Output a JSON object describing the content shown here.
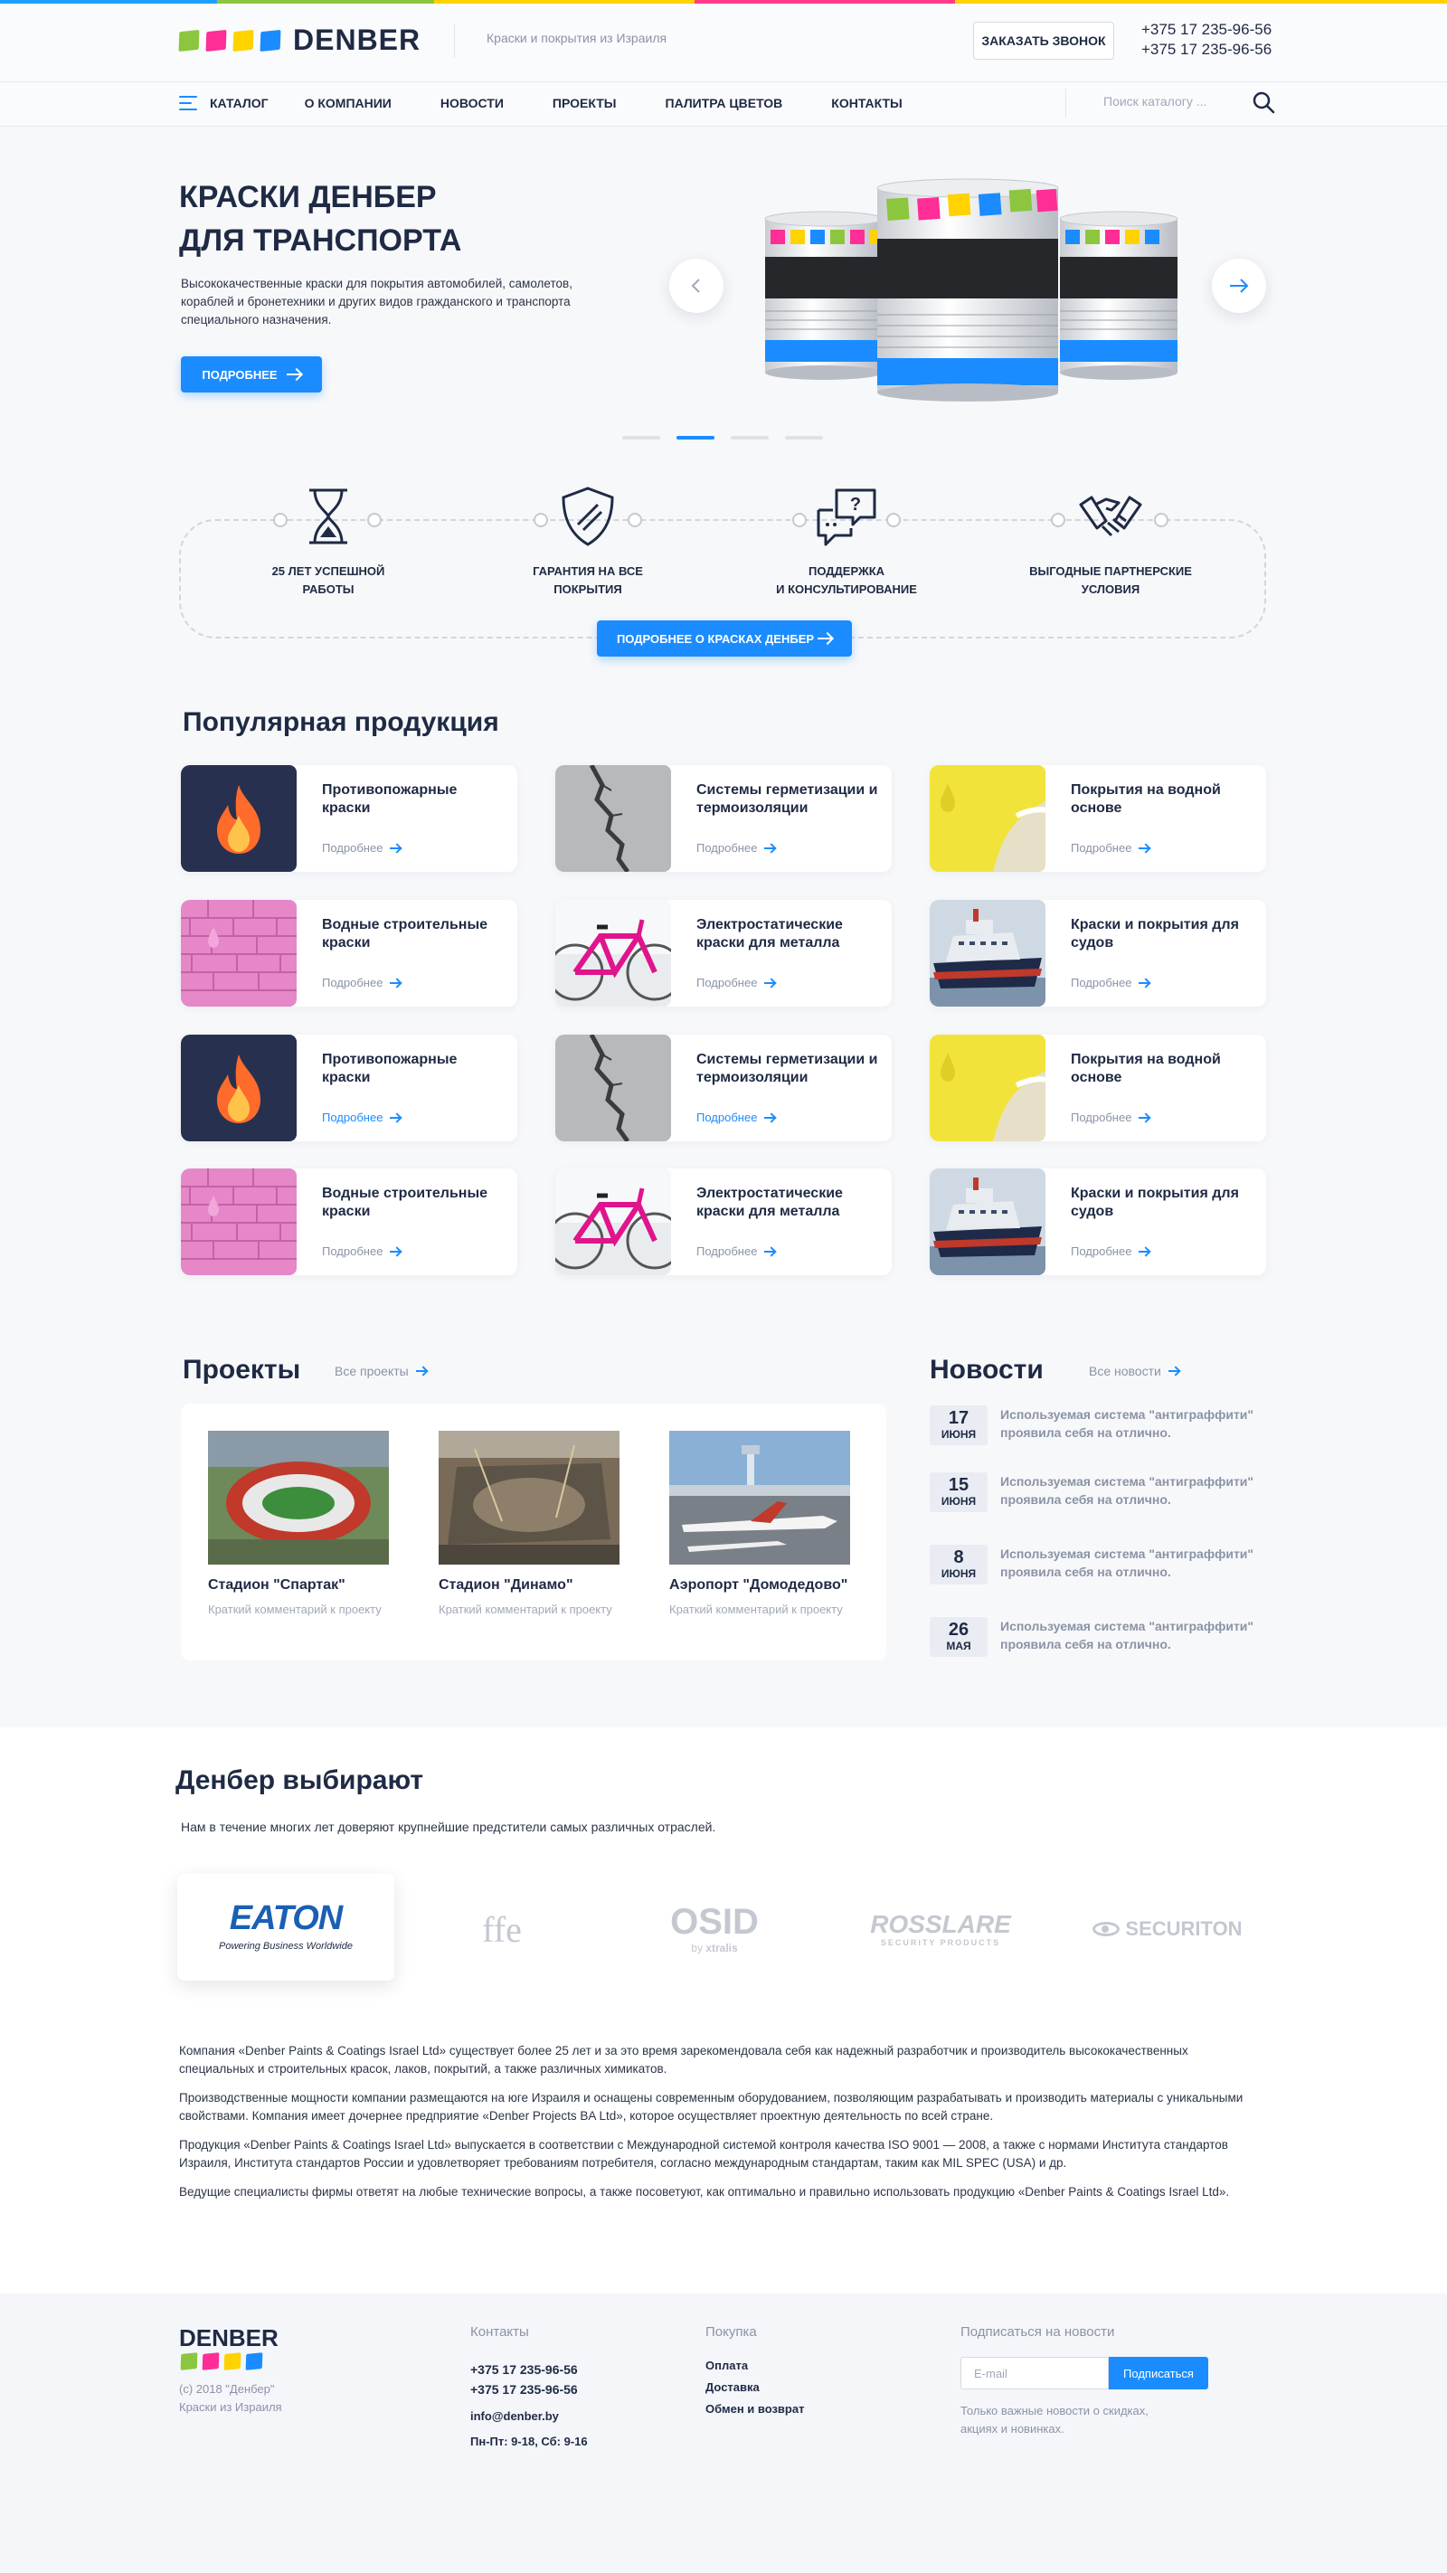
{
  "header": {
    "logo_text": "DENBER",
    "tagline": "Краски и покрытия из Израиля",
    "call_button": "ЗАКАЗАТЬ ЗВОНОК",
    "phone1": "+375 17 235-96-56",
    "phone2": "+375 17 235-96-56",
    "brand_colors": [
      "#8cc63f",
      "#ff2d96",
      "#ffd200",
      "#1a8cff"
    ]
  },
  "nav": {
    "catalog": "КАТАЛОГ",
    "items": [
      "О КОМПАНИИ",
      "НОВОСТИ",
      "ПРОЕКТЫ",
      "ПАЛИТРА ЦВЕТОВ",
      "КОНТАКТЫ"
    ],
    "search_placeholder": "Поиск каталогу ..."
  },
  "hero": {
    "title_line1": "КРАСКИ ДЕНБЕР",
    "title_line2": "ДЛЯ ТРАНСПОРТА",
    "description": "Высококачественные краски для покрытия  автомобилей, самолетов, кораблей и бронетехники и других видов гражданского и транспорта специального назначения.",
    "button": "ПОДРОБНЕЕ",
    "active_slide": 2,
    "slide_count": 4
  },
  "features": {
    "items": [
      {
        "line1": "25 ЛЕТ УСПЕШНОЙ",
        "line2": "РАБОТЫ",
        "icon": "hourglass-icon"
      },
      {
        "line1": "ГАРАНТИЯ НА ВСЕ",
        "line2": "ПОКРЫТИЯ",
        "icon": "shield-icon"
      },
      {
        "line1": "ПОДДЕРЖКА",
        "line2": "И КОНСУЛЬТИРОВАНИЕ",
        "icon": "chat-question-icon"
      },
      {
        "line1": "ВЫГОДНЫЕ ПАРТНЕРСКИЕ",
        "line2": "УСЛОВИЯ",
        "icon": "handshake-icon"
      }
    ],
    "button": "ПОДРОБНЕЕ О КРАСКАХ ДЕНБЕР"
  },
  "popular": {
    "title": "Популярная продукция",
    "more_label": "Подробнее",
    "products": [
      {
        "name": "Противопожарные краски",
        "image": "fire"
      },
      {
        "name": "Системы герметизации и термоизоляции",
        "image": "crack"
      },
      {
        "name": "Покрытия на водной основе",
        "image": "yellow-paint"
      },
      {
        "name": "Водные строительные краски",
        "image": "pink-brick"
      },
      {
        "name": "Электростатические краски для металла",
        "image": "bicycle"
      },
      {
        "name": "Краски и покрытия для судов",
        "image": "ship"
      },
      {
        "name": "Противопожарные краски",
        "image": "fire"
      },
      {
        "name": "Системы герметизации и термоизоляции",
        "image": "crack"
      },
      {
        "name": "Покрытия на водной основе",
        "image": "yellow-paint"
      },
      {
        "name": "Водные строительные краски",
        "image": "pink-brick"
      },
      {
        "name": "Электростатические краски для металла",
        "image": "bicycle"
      },
      {
        "name": "Краски и покрытия для судов",
        "image": "ship"
      }
    ]
  },
  "projects": {
    "title": "Проекты",
    "all_link": "Все проекты",
    "items": [
      {
        "name": "Стадион \"Спартак\"",
        "comment": "Краткий комментарий к проекту"
      },
      {
        "name": "Стадион \"Динамо\"",
        "comment": "Краткий комментарий к проекту"
      },
      {
        "name": "Аэропорт \"Домодедово\"",
        "comment": "Краткий комментарий к проекту"
      }
    ]
  },
  "news": {
    "title": "Новости",
    "all_link": "Все новости",
    "items": [
      {
        "day": "17",
        "month": "ИЮНЯ",
        "text": "Используемая система \"антиграффити\" проявила себя на отлично."
      },
      {
        "day": "15",
        "month": "ИЮНЯ",
        "text": "Используемая система \"антиграффити\" проявила себя на отлично."
      },
      {
        "day": "8",
        "month": "ИЮНЯ",
        "text": "Используемая система \"антиграффити\" проявила себя на отлично."
      },
      {
        "day": "26",
        "month": "МАЯ",
        "text": "Используемая система \"антиграффити\" проявила себя на отлично."
      }
    ]
  },
  "clients": {
    "title": "Денбер выбирают",
    "subtitle": "Нам в течение многих лет доверяют крупнейшие предстители самых различных отраслей.",
    "eaton": "EATON",
    "eaton_tag": "Powering Business Worldwide",
    "logos": [
      "ffe",
      "OSID",
      "ROSSLARE",
      "SECURITON"
    ],
    "osid_by": "by",
    "osid_brand": "xtralis",
    "rosslare_sub": "SECURITY PRODUCTS"
  },
  "about": {
    "paragraphs": [
      "Компания «Denber Paints & Coatings Israel Ltd» существует более 25 лет и за это время зарекомендовала себя как надежный разработчик и производитель высококачественных специальных и строительных красок, лаков, покрытий, а также различных химикатов.",
      "Производственные мощности компании размещаются на юге Израиля и оснащены современным оборудованием, позволяющим разрабатывать и производить материалы с уникальными свойствами. Компания имеет дочернее предприятие «Denber Projects BA Ltd», которое осуществляет проектную деятельность по всей стране.",
      "Продукция «Denber Paints & Coatings Israel Ltd» выпускается в соответствии с Международной системой контроля качества ISO 9001 — 2008, а также с нормами Института стандартов Израиля, Института стандартов России и удовлетворяет требованиям потребителя, согласно международным стандартам, таким как MIL SPEC (USA) и др.",
      "Ведущие специалисты фирмы ответят на любые технические вопросы, а также посоветуют, как оптимально и правильно использовать продукцию «Denber Paints & Coatings Israel Ltd»."
    ]
  },
  "footer": {
    "logo_text": "DENBER",
    "copyright": "(c) 2018 \"Денбер\"",
    "copyright2": "Краски из Израиля",
    "contacts_title": "Контакты",
    "phone1": "+375 17 235-96-56",
    "phone2": "+375 17 235-96-56",
    "email": "info@denber.by",
    "hours": "Пн-Пт: 9-18, Сб: 9-16",
    "purchase_title": "Покупка",
    "purchase_items": [
      "Оплата",
      "Доставка",
      "Обмен и возврат"
    ],
    "subscribe_title": "Подписаться на новости",
    "email_placeholder": "E-mail",
    "subscribe_button": "Подписаться",
    "subscribe_note": "Только важные новости о скидках, акциях и новинках."
  }
}
